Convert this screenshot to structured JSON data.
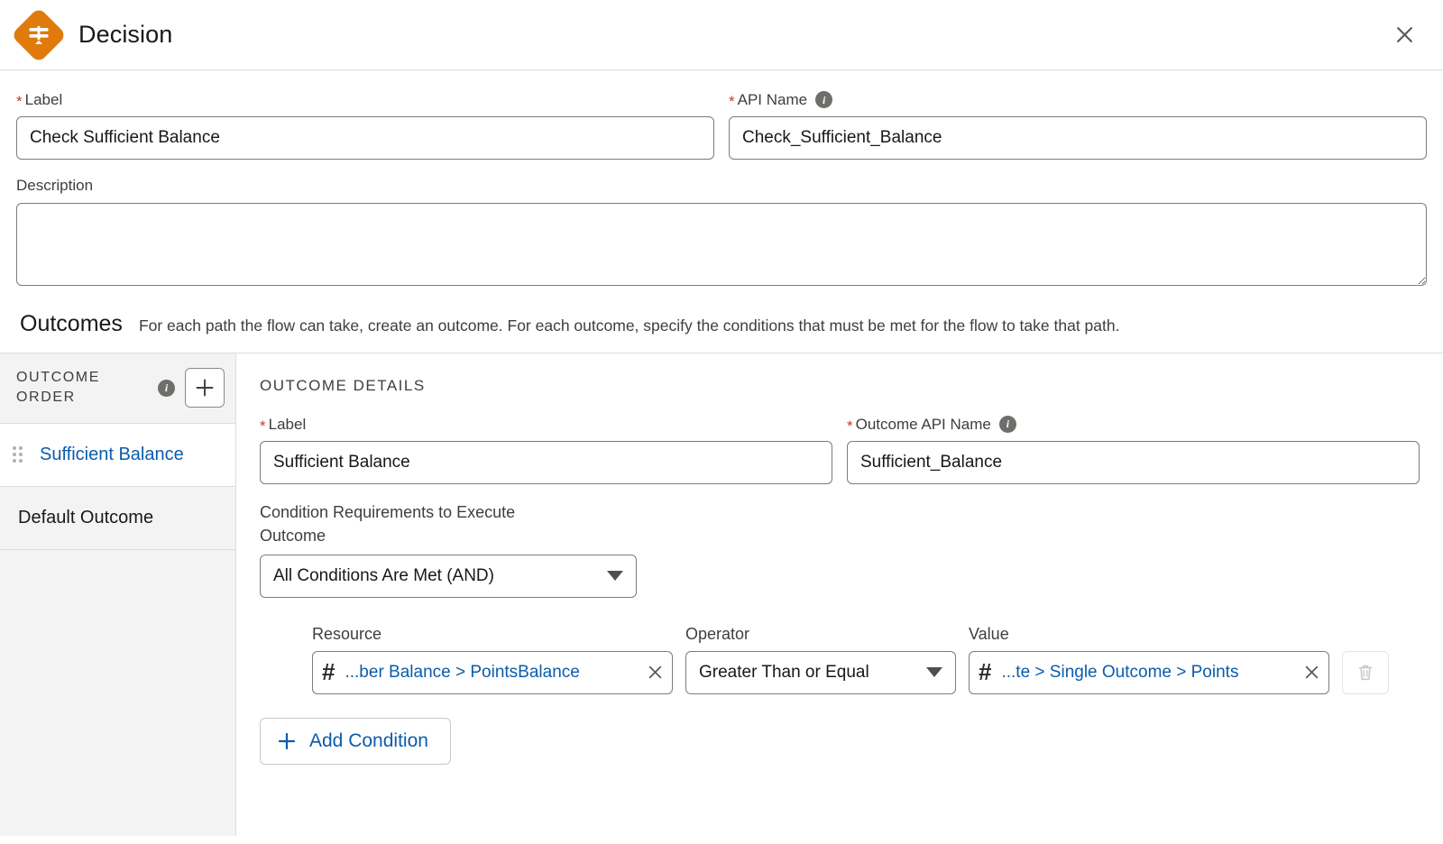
{
  "header": {
    "title": "Decision",
    "icon": "decision-diamond-icon",
    "close_icon": "close-icon",
    "accent_color": "#df7a0b"
  },
  "top_form": {
    "label_field": {
      "label": "Label",
      "required": true,
      "value": "Check Sufficient Balance"
    },
    "api_name_field": {
      "label": "API Name",
      "required": true,
      "value": "Check_Sufficient_Balance",
      "info_icon": "info-icon"
    },
    "description_field": {
      "label": "Description",
      "value": "",
      "placeholder": ""
    }
  },
  "outcomes_section": {
    "title": "Outcomes",
    "subtitle": "For each path the flow can take, create an outcome. For each outcome, specify the conditions that must be met for the flow to take that path."
  },
  "sidebar": {
    "heading": "OUTCOME ORDER",
    "info_icon": "info-icon",
    "add_button_icon": "plus-icon",
    "items": [
      {
        "label": "Sufficient Balance",
        "selected": true,
        "draggable": true
      },
      {
        "label": "Default Outcome",
        "selected": false,
        "draggable": false
      }
    ]
  },
  "outcome_details": {
    "heading": "OUTCOME DETAILS",
    "label_field": {
      "label": "Label",
      "required": true,
      "value": "Sufficient Balance"
    },
    "api_name_field": {
      "label": "Outcome API Name",
      "required": true,
      "value": "Sufficient_Balance",
      "info_icon": "info-icon"
    },
    "condition_requirements": {
      "label": "Condition Requirements to Execute Outcome",
      "selected": "All Conditions Are Met (AND)"
    },
    "condition_row": {
      "resource_label": "Resource",
      "resource_value": "...ber Balance > PointsBalance",
      "resource_icon": "hash-number-icon",
      "resource_clear_icon": "close-icon",
      "operator_label": "Operator",
      "operator_value": "Greater Than or Equal",
      "value_label": "Value",
      "value_value": "...te > Single Outcome > Points",
      "value_icon": "hash-number-icon",
      "value_clear_icon": "close-icon",
      "delete_icon": "trash-icon"
    },
    "add_condition_label": "Add Condition",
    "add_condition_icon": "plus-icon"
  },
  "colors": {
    "link_blue": "#0b5cab",
    "required_red": "#c23934",
    "icon_gray": "#706e6b"
  }
}
